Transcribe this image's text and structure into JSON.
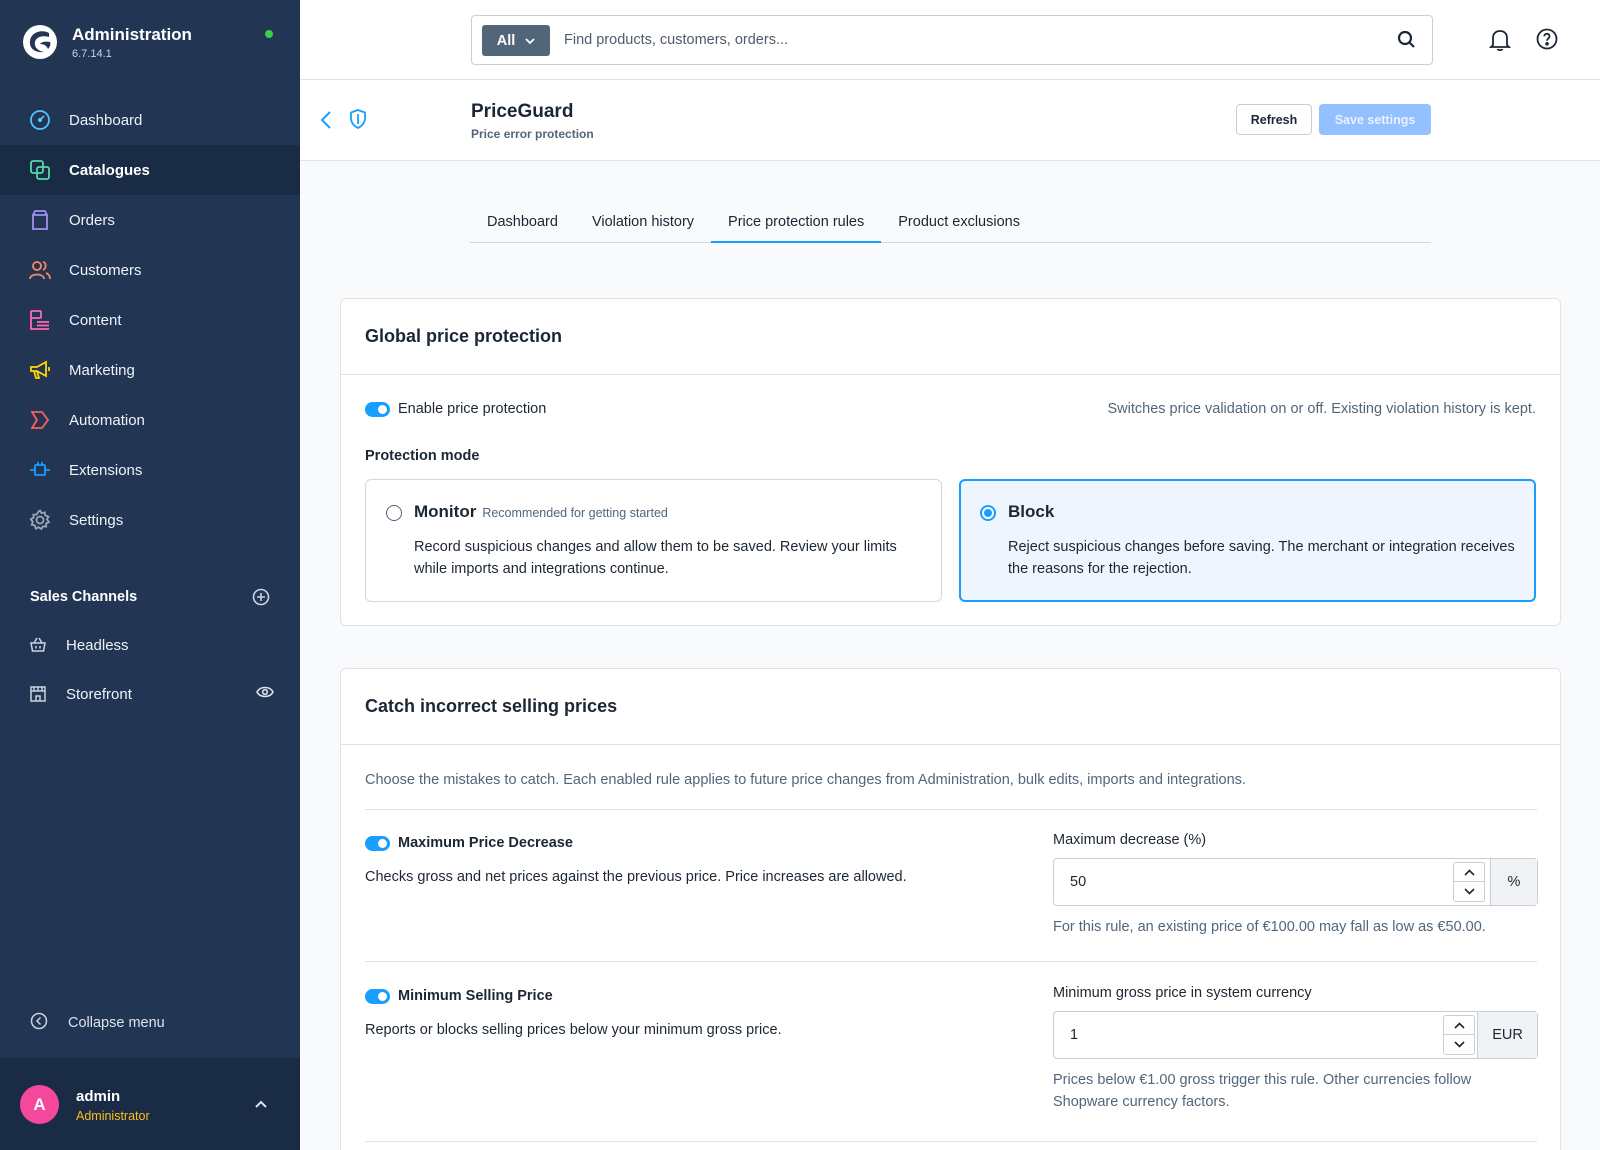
{
  "app": {
    "title": "Administration",
    "version": "6.7.14.1",
    "online_status_color": "#37d046"
  },
  "nav": {
    "items": [
      {
        "label": "Dashboard",
        "icon": "gauge-icon",
        "color": "#4dc3ff"
      },
      {
        "label": "Catalogues",
        "icon": "products-icon",
        "color": "#57d9a3",
        "active": true
      },
      {
        "label": "Orders",
        "icon": "shopping-bag-icon",
        "color": "#a092f0"
      },
      {
        "label": "Customers",
        "icon": "users-icon",
        "color": "#f88962"
      },
      {
        "label": "Content",
        "icon": "content-icon",
        "color": "#ff68b4"
      },
      {
        "label": "Marketing",
        "icon": "megaphone-icon",
        "color": "#ffd700"
      },
      {
        "label": "Automation",
        "icon": "automation-icon",
        "color": "#ff5c5c"
      },
      {
        "label": "Extensions",
        "icon": "plug-icon",
        "color": "#189eff"
      },
      {
        "label": "Settings",
        "icon": "gear-icon",
        "color": "#9aa8b5"
      }
    ]
  },
  "sales_channels": {
    "title": "Sales Channels",
    "items": [
      {
        "label": "Headless",
        "icon": "basket-icon"
      },
      {
        "label": "Storefront",
        "icon": "storefront-icon"
      }
    ]
  },
  "sidebar_footer": {
    "collapse_label": "Collapse menu"
  },
  "user": {
    "initial": "A",
    "name": "admin",
    "role": "Administrator",
    "avatar_color": "#f5479c"
  },
  "search": {
    "type_label": "All",
    "placeholder": "Find products, customers, orders..."
  },
  "page": {
    "title": "PriceGuard",
    "subtitle": "Price error protection",
    "refresh_label": "Refresh",
    "save_label": "Save settings"
  },
  "tabs": [
    {
      "label": "Dashboard"
    },
    {
      "label": "Violation history"
    },
    {
      "label": "Price protection rules",
      "active": true
    },
    {
      "label": "Product exclusions"
    }
  ],
  "global": {
    "title": "Global price protection",
    "enable_label": "Enable price protection",
    "enabled": true,
    "enable_help": "Switches price validation on or off. Existing violation history is kept.",
    "mode_label": "Protection mode",
    "monitor": {
      "title": "Monitor",
      "badge": "Recommended for getting started",
      "description": "Record suspicious changes and allow them to be saved. Review your limits while imports and integrations continue.",
      "selected": false
    },
    "block": {
      "title": "Block",
      "description": "Reject suspicious changes before saving. The merchant or integration receives the reasons for the rejection.",
      "selected": true
    }
  },
  "rules_card": {
    "title": "Catch incorrect selling prices",
    "intro": "Choose the mistakes to catch. Each enabled rule applies to future price changes from Administration, bulk edits, imports and integrations.",
    "rules": [
      {
        "title": "Maximum Price Decrease",
        "enabled": true,
        "description": "Checks gross and net prices against the previous price. Price increases are allowed.",
        "field_label": "Maximum decrease (%)",
        "value": "50",
        "suffix": "%",
        "help": "For this rule, an existing price of €100.00 may fall as low as €50.00."
      },
      {
        "title": "Minimum Selling Price",
        "enabled": true,
        "description": "Reports or blocks selling prices below your minimum gross price.",
        "field_label": "Minimum gross price in system currency",
        "value": "1",
        "suffix": "EUR",
        "help": "Prices below €1.00 gross trigger this rule. Other currencies follow Shopware currency factors."
      }
    ]
  },
  "colors": {
    "sidebar": "#223654",
    "accent": "#189eff",
    "save_disabled": "#93c0ff"
  }
}
